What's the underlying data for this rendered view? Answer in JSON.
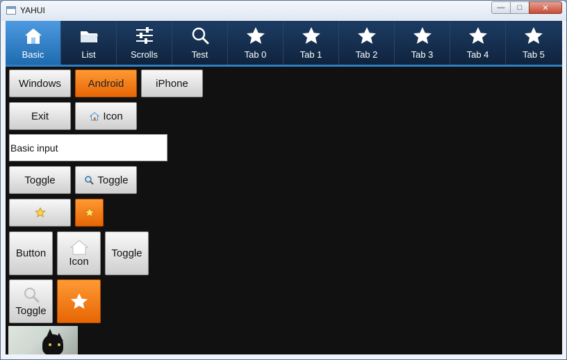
{
  "window": {
    "title": "YAHUI",
    "buttons": {
      "minimize": "—",
      "maximize": "□",
      "close": "✕"
    }
  },
  "tabs": [
    {
      "label": "Basic",
      "icon": "home-icon",
      "active": true
    },
    {
      "label": "List",
      "icon": "folder-icon",
      "active": false
    },
    {
      "label": "Scrolls",
      "icon": "sliders-icon",
      "active": false
    },
    {
      "label": "Test",
      "icon": "search-icon",
      "active": false
    },
    {
      "label": "Tab 0",
      "icon": "star-icon",
      "active": false
    },
    {
      "label": "Tab 1",
      "icon": "star-icon",
      "active": false
    },
    {
      "label": "Tab 2",
      "icon": "star-icon",
      "active": false
    },
    {
      "label": "Tab 3",
      "icon": "star-icon",
      "active": false
    },
    {
      "label": "Tab 4",
      "icon": "star-icon",
      "active": false
    },
    {
      "label": "Tab 5",
      "icon": "star-icon",
      "active": false
    }
  ],
  "buttons": {
    "windows": "Windows",
    "android": "Android",
    "iphone": "iPhone",
    "exit": "Exit",
    "icon": "Icon",
    "toggle1": "Toggle",
    "toggle2": "Toggle",
    "button": "Button",
    "icon_large": "Icon",
    "toggle3": "Toggle",
    "toggle_large": "Toggle"
  },
  "input": {
    "value": "Basic input"
  },
  "colors": {
    "accent": "#2f80c3",
    "orange": "#ff8a1a"
  }
}
